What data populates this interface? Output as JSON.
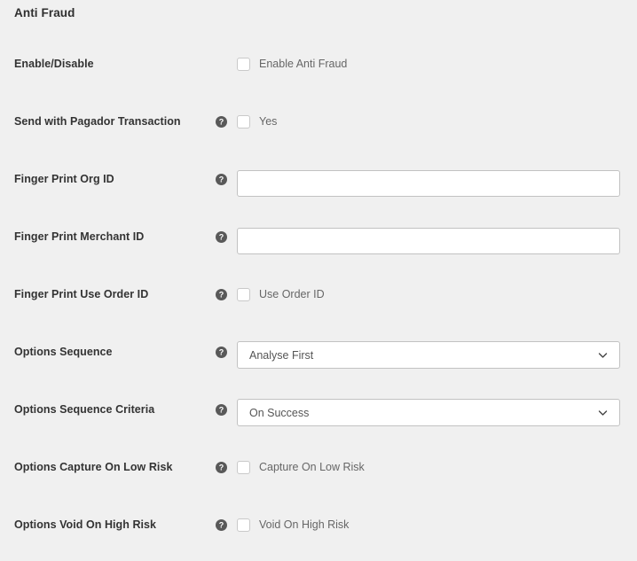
{
  "section": {
    "title": "Anti Fraud"
  },
  "icons": {
    "help": "help-circle-icon",
    "chevron": "chevron-down-icon",
    "checkbox": "checkbox-icon"
  },
  "colors": {
    "background": "#f0f0f0",
    "label_text": "#333333",
    "secondary_text": "#666666",
    "input_border": "#c2c2c2",
    "checkbox_border": "#c9c9c9",
    "help_icon_bg": "#595959",
    "field_background": "#ffffff"
  },
  "rows": [
    {
      "label": "Enable/Disable",
      "has_help": false,
      "type": "checkbox",
      "checkbox_label": "Enable Anti Fraud",
      "checked": false
    },
    {
      "label": "Send with Pagador Transaction",
      "has_help": true,
      "type": "checkbox",
      "checkbox_label": "Yes",
      "checked": false
    },
    {
      "label": "Finger Print Org ID",
      "has_help": true,
      "type": "text",
      "value": "",
      "placeholder": ""
    },
    {
      "label": "Finger Print Merchant ID",
      "has_help": true,
      "type": "text",
      "value": "",
      "placeholder": ""
    },
    {
      "label": "Finger Print Use Order ID",
      "has_help": true,
      "type": "checkbox",
      "checkbox_label": "Use Order ID",
      "checked": false
    },
    {
      "label": "Options Sequence",
      "has_help": true,
      "type": "select",
      "value": "Analyse First"
    },
    {
      "label": "Options Sequence Criteria",
      "has_help": true,
      "type": "select",
      "value": "On Success"
    },
    {
      "label": "Options Capture On Low Risk",
      "has_help": true,
      "type": "checkbox",
      "checkbox_label": "Capture On Low Risk",
      "checked": false
    },
    {
      "label": "Options Void On High Risk",
      "has_help": true,
      "type": "checkbox",
      "checkbox_label": "Void On High Risk",
      "checked": false
    }
  ]
}
